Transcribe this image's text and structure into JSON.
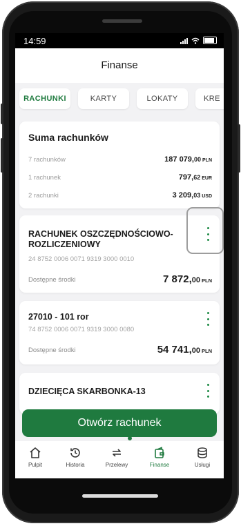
{
  "status": {
    "time": "14:59"
  },
  "header": {
    "title": "Finanse"
  },
  "tabs": [
    {
      "label": "RACHUNKI",
      "active": true
    },
    {
      "label": "KARTY",
      "active": false
    },
    {
      "label": "LOKATY",
      "active": false
    },
    {
      "label": "KRE",
      "active": false
    }
  ],
  "summary": {
    "title": "Suma rachunków",
    "rows": [
      {
        "label": "7 rachunków",
        "amount": "187 079,",
        "decimals": "00",
        "currency": "PLN"
      },
      {
        "label": "1 rachunek",
        "amount": "797,",
        "decimals": "62",
        "currency": "EUR"
      },
      {
        "label": "2 rachunki",
        "amount": "3 209,",
        "decimals": "03",
        "currency": "USD"
      }
    ]
  },
  "accounts": [
    {
      "name_line1": "RACHUNEK OSZCZĘDNOŚCIOWO-",
      "name_line2": "ROZLICZENIOWY",
      "number": "24 8752 0006 0071 9319 3000 0010",
      "available_label": "Dostępne środki",
      "amount": "7 872,",
      "decimals": "00",
      "currency": "PLN"
    },
    {
      "name_line1": "27010 - 101 ror",
      "number": "74 8752 0006 0071 9319 3000 0080",
      "available_label": "Dostępne środki",
      "amount": "54 741,",
      "decimals": "00",
      "currency": "PLN"
    },
    {
      "name_line1": "DZIECIĘCA SKARBONKA-13"
    }
  ],
  "open_button": {
    "label": "Otwórz rachunek"
  },
  "nav": [
    {
      "label": "Pulpit",
      "icon": "home-icon"
    },
    {
      "label": "Historia",
      "icon": "history-icon"
    },
    {
      "label": "Przelewy",
      "icon": "transfer-icon"
    },
    {
      "label": "Finanse",
      "icon": "finance-icon",
      "active": true
    },
    {
      "label": "Usługi",
      "icon": "services-icon"
    }
  ],
  "colors": {
    "accent": "#1f7a3f",
    "background": "#f2f2f4"
  }
}
